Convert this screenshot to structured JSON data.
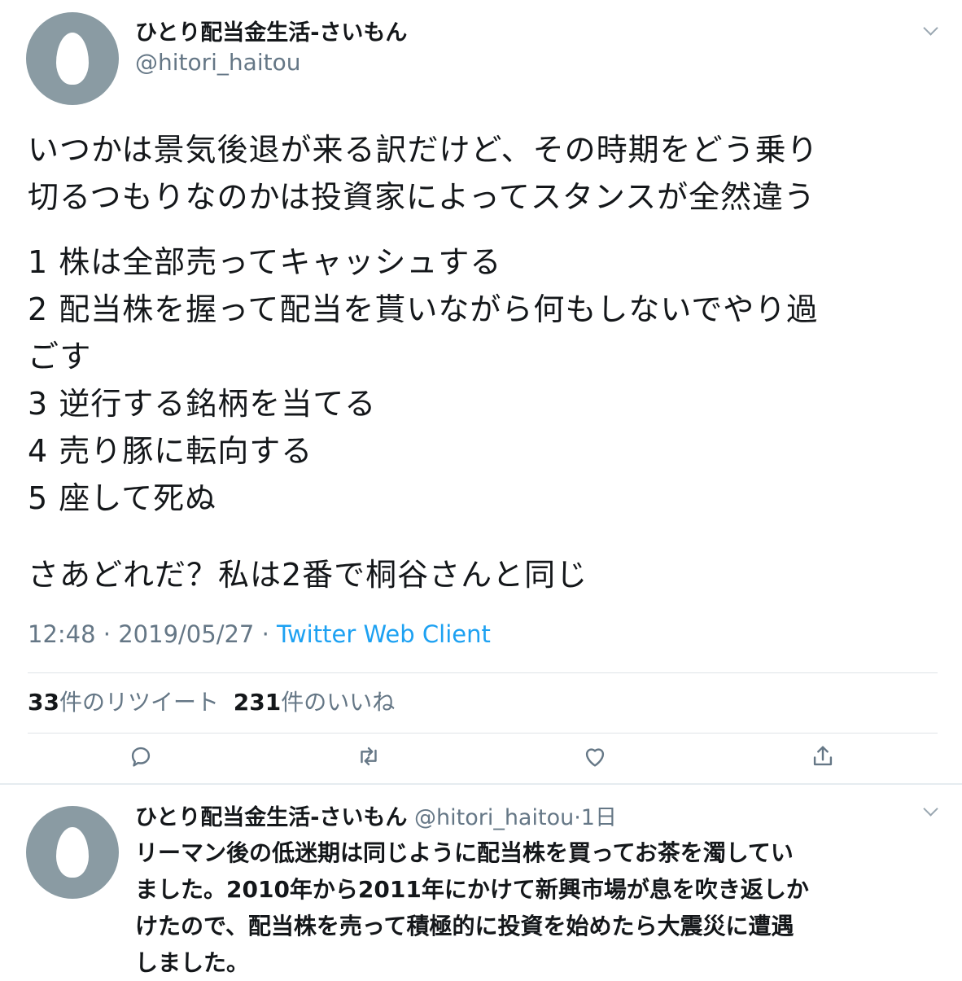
{
  "tweet": {
    "author": {
      "name": "ひとり配当金生活-さいもん",
      "handle": "@hitori_haitou",
      "avatar_color": "#8a9ba3"
    },
    "paragraph1": [
      "いつかは景気後退が来る訳だけど、その時期をどう乗り",
      "切るつもりなのかは投資家によってスタンスが全然違う"
    ],
    "list": [
      "1 株は全部売ってキャッシュする",
      "2 配当株を握って配当を貰いながら何もしないでやり過",
      "ごす",
      "3 逆行する銘柄を当てる",
      "4 売り豚に転向する",
      "5 座して死ぬ"
    ],
    "closing": "さあどれだ？私は2番で桐谷さんと同じ",
    "time": "12:48",
    "date": "2019/05/27",
    "separator": "·",
    "client": "Twitter Web Client",
    "retweet_count": "33",
    "retweet_label": "件のリツイート",
    "like_count": "231",
    "like_label": "件のいいね"
  },
  "actions": {
    "icons": [
      "reply-icon",
      "retweet-icon",
      "like-icon",
      "share-icon"
    ],
    "color": "#657786"
  },
  "reply": {
    "name": "ひとり配当金生活-さいもん",
    "handle": "@hitori_haitou",
    "separator": "·",
    "age": "1日",
    "lines": [
      "リーマン後の低迷期は同じように配当株を買ってお茶を濁してい",
      "ました。2010年から2011年にかけて新興市場が息を吹き返しか",
      "けたので、配当株を売って積極的に投資を始めたら大震災に遭遇",
      "しました。"
    ]
  },
  "colors": {
    "link": "#1da1f2",
    "muted": "#657786",
    "text": "#14171a"
  }
}
